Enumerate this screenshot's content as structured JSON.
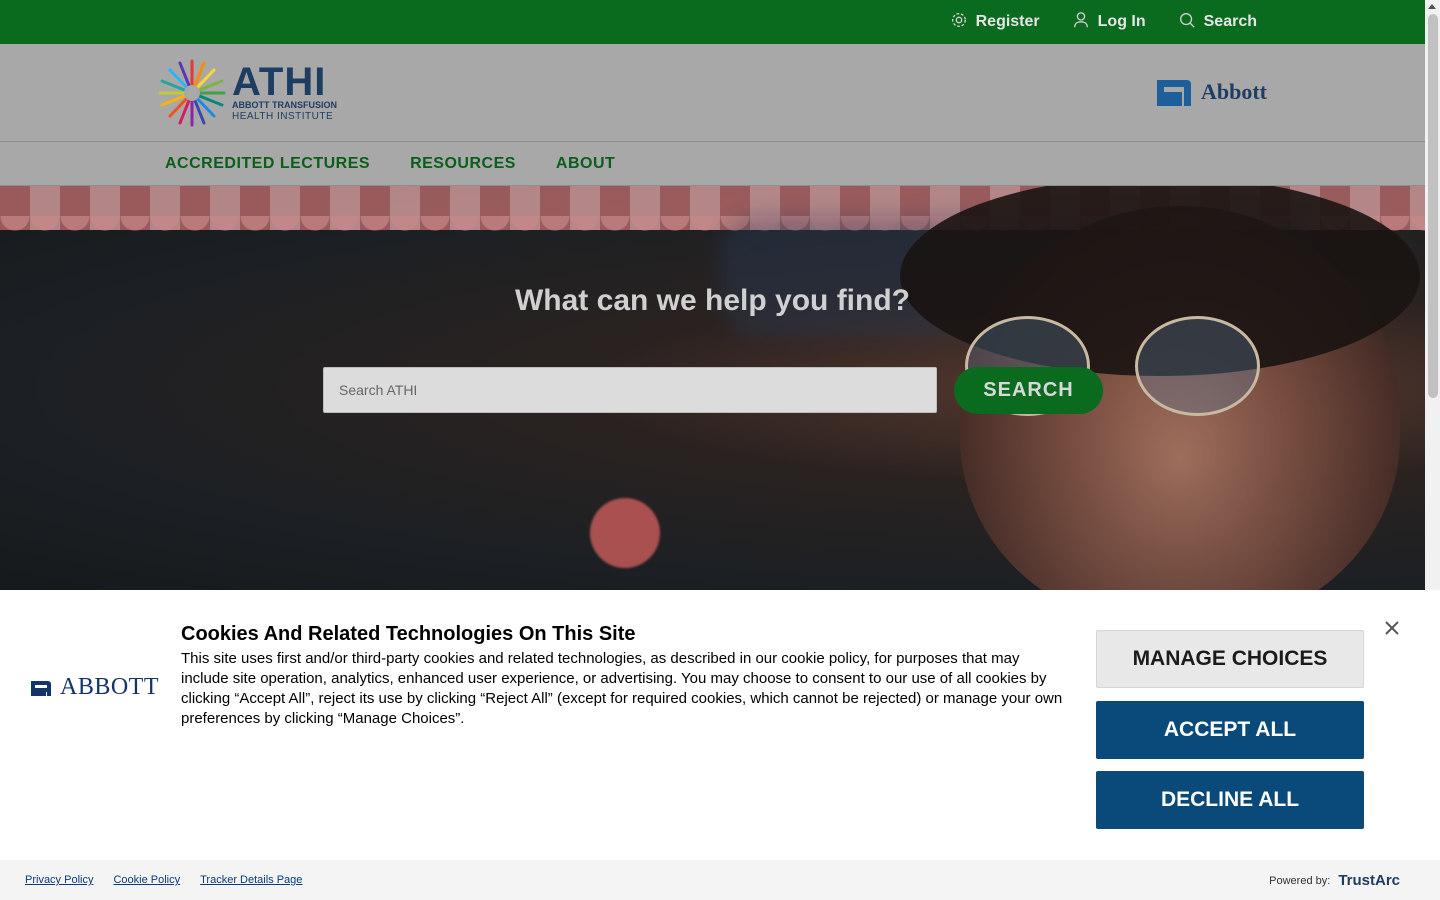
{
  "topbar": {
    "register": "Register",
    "login": "Log In",
    "search": "Search"
  },
  "header": {
    "logo_title": "ATHI",
    "logo_sub1": "ABBOTT TRANSFUSION",
    "logo_sub2": "HEALTH INSTITUTE",
    "brand": "Abbott"
  },
  "nav": {
    "items": [
      "ACCREDITED LECTURES",
      "RESOURCES",
      "ABOUT"
    ]
  },
  "hero": {
    "title": "What can we help you find?",
    "search_placeholder": "Search ATHI",
    "search_button": "SEARCH"
  },
  "cookie": {
    "brand": "ABBOTT",
    "title": "Cookies And Related Technologies On This Site",
    "text": "This site uses first and/or third-party cookies and related technologies, as described in our cookie policy, for purposes that may include site operation, analytics, enhanced user experience, or advertising. You may choose to consent to our use of all cookies by clicking “Accept All”, reject its use by clicking “Reject All” (except for required cookies, which cannot be rejected) or manage your own preferences by clicking “Manage Choices”.",
    "manage": "MANAGE CHOICES",
    "accept": "ACCEPT ALL",
    "decline": "DECLINE ALL",
    "footer_links": [
      "Privacy Policy",
      "Cookie Policy",
      "Tracker Details Page"
    ],
    "powered_by": "Powered by:",
    "powered_brand": "TrustArc"
  },
  "colors": {
    "topbar": "#0a6a1e",
    "header_bg": "#a8a8a8",
    "nav_text": "#0a5e1a",
    "cookie_button": "#0a4a7a"
  },
  "icons": [
    "gear-icon",
    "user-icon",
    "search-icon",
    "close-icon",
    "athi-logo",
    "abbott-logo"
  ]
}
